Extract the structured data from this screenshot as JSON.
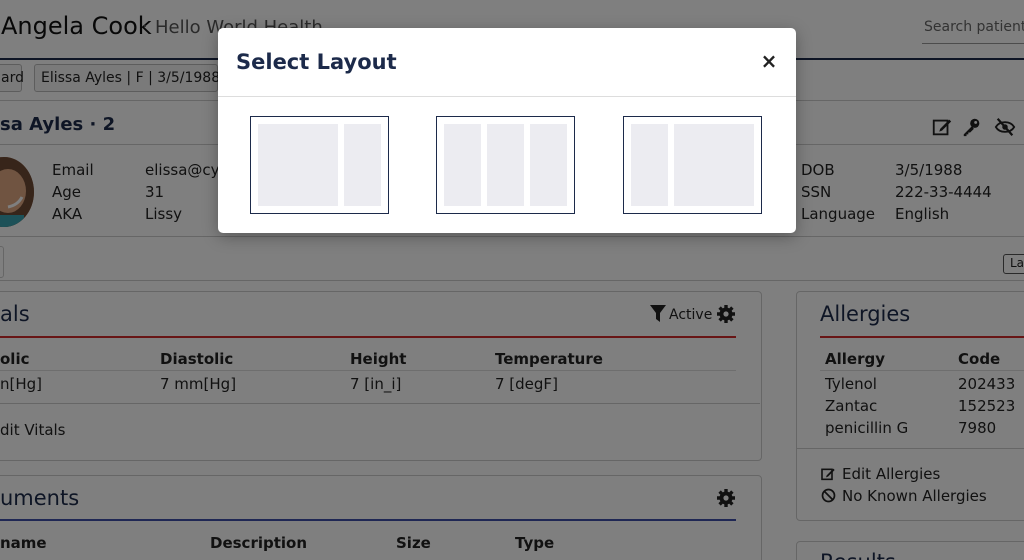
{
  "header": {
    "provider_name": "Angela Cook",
    "separator": "·",
    "org_name": "Hello World Health",
    "search_placeholder": "Search patients"
  },
  "tabs": [
    {
      "label": "ard"
    },
    {
      "label": "Elissa Ayles | F | 3/5/1988"
    }
  ],
  "patient": {
    "title": "sa Ayles · 2",
    "details_left": [
      {
        "label": "Email",
        "value": "elissa@cyb"
      },
      {
        "label": "Age",
        "value": "31"
      },
      {
        "label": "AKA",
        "value": "Lissy"
      }
    ],
    "details_right": [
      {
        "label": "DOB",
        "value": "3/5/1988"
      },
      {
        "label": "SSN",
        "value": "222-33-4444"
      },
      {
        "label": "Language",
        "value": "English"
      }
    ]
  },
  "right_tab": "La",
  "vitals": {
    "title": "als",
    "filter_label": "Active",
    "columns": [
      "olic",
      "Diastolic",
      "Height",
      "Temperature"
    ],
    "row": [
      "n[Hg]",
      "7 mm[Hg]",
      "7 [in_i]",
      "7 [degF]"
    ],
    "edit_label": "dit Vitals",
    "accent": "#d12b2b"
  },
  "documents": {
    "title": "uments",
    "columns": [
      "name",
      "Description",
      "Size",
      "Type"
    ],
    "accent": "#3f4fa8"
  },
  "allergies": {
    "title": "Allergies",
    "columns": [
      "Allergy",
      "Code"
    ],
    "rows": [
      [
        "Tylenol",
        "202433"
      ],
      [
        "Zantac",
        "152523"
      ],
      [
        "penicillin G",
        "7980"
      ]
    ],
    "edit_label": "Edit Allergies",
    "nka_label": "No Known Allergies",
    "accent": "#d12b2b"
  },
  "results": {
    "title": "Results"
  },
  "modal": {
    "title": "Select Layout",
    "close_label": "×",
    "options": [
      {
        "name": "wide-narrow"
      },
      {
        "name": "three-equal"
      },
      {
        "name": "narrow-wide"
      }
    ]
  },
  "colors": {
    "navy": "#1c2a4a",
    "backdrop": "rgba(0,0,0,0.5)",
    "placeholder_col": "#ececf1"
  }
}
